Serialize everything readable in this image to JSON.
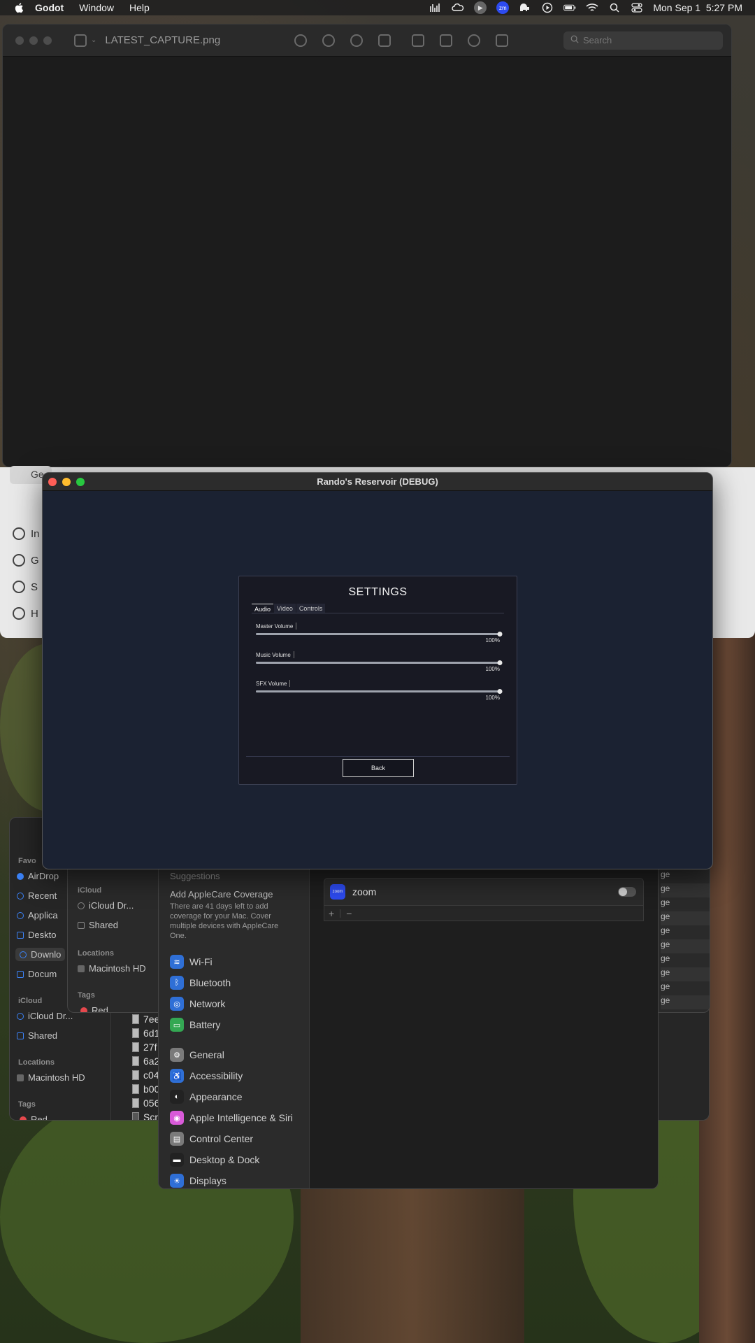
{
  "menubar": {
    "app_name": "Godot",
    "menus": [
      "Window",
      "Help"
    ],
    "zoom_icon_text": "zm",
    "datetime": "Mon Sep 1  5:27 PM"
  },
  "preview": {
    "filename": "LATEST_CAPTURE.png",
    "search_placeholder": "Search"
  },
  "background_app": {
    "button_fragment": "Ge",
    "rows": [
      "In",
      "G",
      "S",
      "H"
    ]
  },
  "finder": {
    "favorites_label": "Favo",
    "favorites": [
      "AirDrop",
      "Recent",
      "Applica",
      "Deskto",
      "Downlo",
      "Docum"
    ],
    "icloud_label": "iCloud",
    "icloud_items": [
      "iCloud Dr...",
      "Shared"
    ],
    "locations_label": "Locations",
    "locations": [
      "Macintosh HD"
    ],
    "tags_label": "Tags",
    "tags": [
      "Red"
    ],
    "files": [
      "7ee",
      "6d1",
      "27f",
      "6a2",
      "c04",
      "b00",
      "056",
      "Scr"
    ],
    "second_window": {
      "icloud_label": "iCloud",
      "icloud_items": [
        "iCloud Dr...",
        "Shared"
      ],
      "locations_label": "Locations",
      "locations": [
        "Macintosh HD"
      ],
      "tags_label": "Tags",
      "tags": [
        "Red"
      ],
      "age_values": [
        "ge",
        "ge",
        "ge",
        "ge",
        "ge",
        "ge",
        "ge",
        "ge",
        "ge",
        "ge",
        "ge"
      ]
    }
  },
  "system_settings": {
    "suggestions_label": "Suggestions",
    "applecare_title": "Add AppleCare Coverage",
    "applecare_desc": "There are 41 days left to add coverage for your Mac. Cover multiple devices with AppleCare One.",
    "items": [
      {
        "label": "Wi-Fi",
        "icon": "wifi-icon",
        "color": "#2f6fd6"
      },
      {
        "label": "Bluetooth",
        "icon": "bluetooth-icon",
        "color": "#2f6fd6"
      },
      {
        "label": "Network",
        "icon": "globe-icon",
        "color": "#2f6fd6"
      },
      {
        "label": "Battery",
        "icon": "battery-icon",
        "color": "#34a853"
      },
      {
        "label": "General",
        "icon": "gear-icon",
        "color": "#7a7a7a"
      },
      {
        "label": "Accessibility",
        "icon": "accessibility-icon",
        "color": "#2f6fd6"
      },
      {
        "label": "Appearance",
        "icon": "appearance-icon",
        "color": "#222222"
      },
      {
        "label": "Apple Intelligence & Siri",
        "icon": "siri-icon",
        "color": "#d85ad8"
      },
      {
        "label": "Control Center",
        "icon": "control-center-icon",
        "color": "#7a7a7a"
      },
      {
        "label": "Desktop & Dock",
        "icon": "dock-icon",
        "color": "#222222"
      },
      {
        "label": "Displays",
        "icon": "displays-icon",
        "color": "#2f6fd6"
      }
    ],
    "app_row": {
      "name": "zoom",
      "logo_text": "zoom",
      "enabled": false
    },
    "add_label": "+",
    "remove_label": "−"
  },
  "game": {
    "window_title": "Rando's Reservoir (DEBUG)",
    "panel_title": "SETTINGS",
    "tabs": [
      "Audio",
      "Video",
      "Controls"
    ],
    "active_tab": "Audio",
    "sliders": [
      {
        "label": "Master Volume",
        "value": 100,
        "display": "100%"
      },
      {
        "label": "Music Volume",
        "value": 100,
        "display": "100%"
      },
      {
        "label": "SFX Volume",
        "value": 100,
        "display": "100%"
      }
    ],
    "back_label": "Back"
  }
}
